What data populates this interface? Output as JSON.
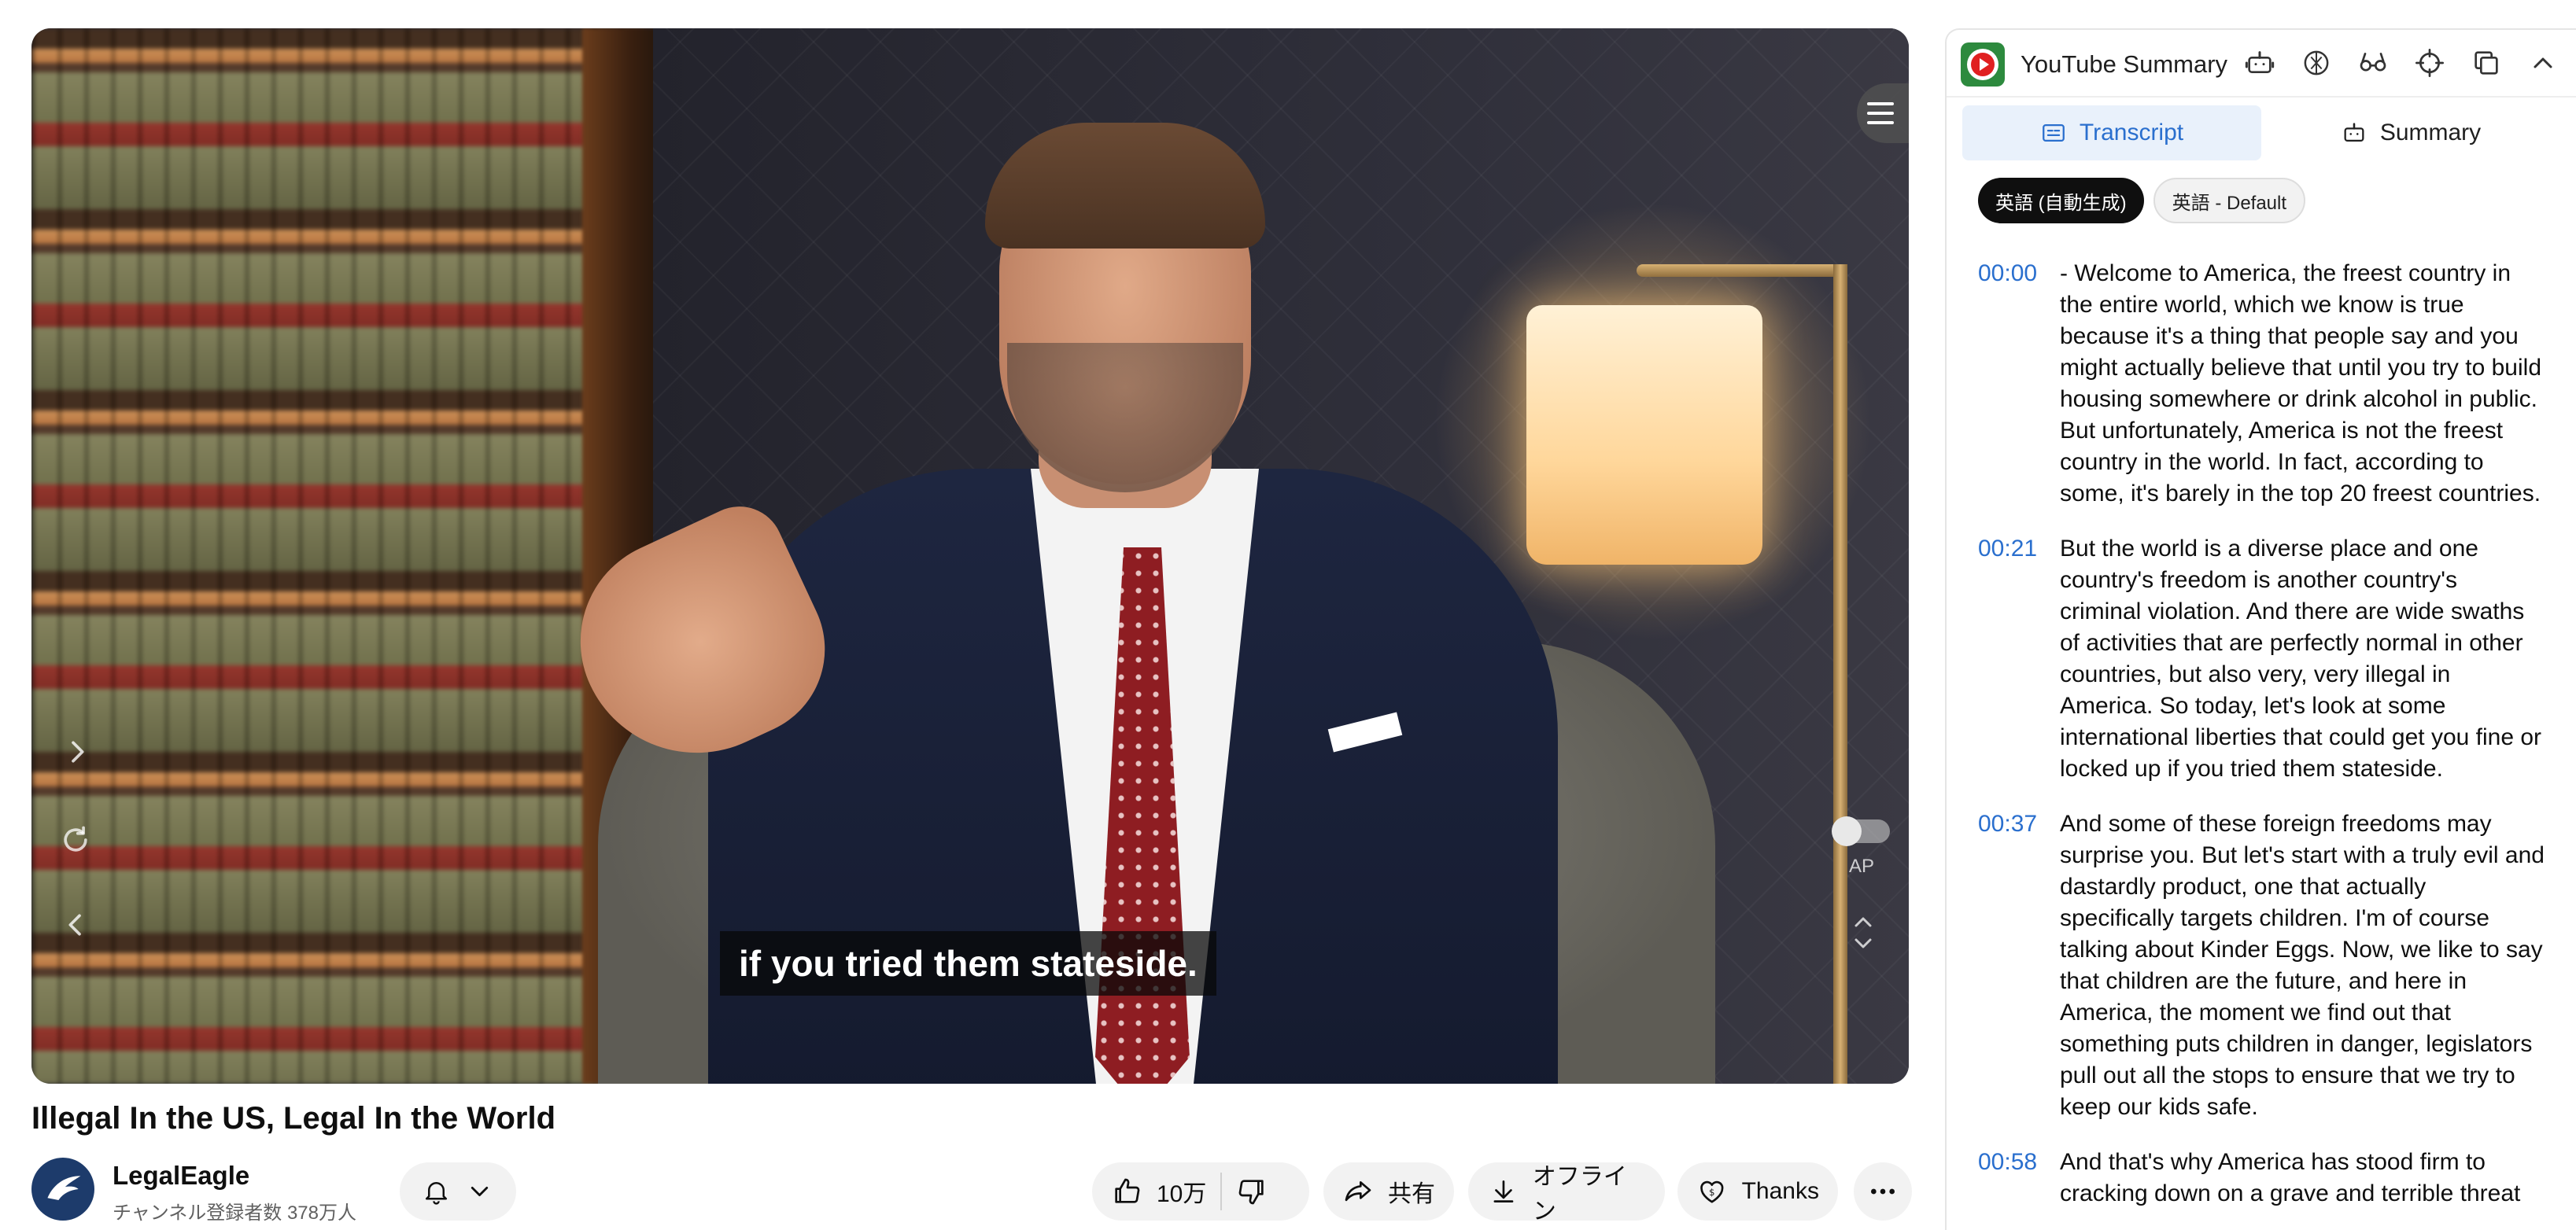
{
  "player": {
    "caption": "if you tried them stateside.",
    "ap_label": "AP"
  },
  "video": {
    "title": "Illegal In the US, Legal In the World",
    "channel_name": "LegalEagle",
    "subscribers": "チャンネル登録者数 378万人",
    "like_count": "10万",
    "share_label": "共有",
    "offline_label": "オフライン",
    "thanks_label": "Thanks"
  },
  "sidebar": {
    "title": "YouTube Summary",
    "header_icons": [
      "robot-icon",
      "openai-icon",
      "glasses-icon",
      "crosshair-icon",
      "copy-icon",
      "chevron-up-icon"
    ],
    "tabs": [
      {
        "label": "Transcript",
        "icon": "transcript-icon",
        "active": true
      },
      {
        "label": "Summary",
        "icon": "robot-icon",
        "active": false
      }
    ],
    "languages": [
      {
        "label": "英語 (自動生成)",
        "active": true
      },
      {
        "label": "英語 - Default",
        "active": false
      }
    ],
    "transcript": [
      {
        "time": "00:00",
        "text": "- Welcome to America, the freest country in the entire world, which we know is true because it's a thing that people say and you might actually believe that until you try to build housing somewhere or drink alcohol in public. But unfortunately, America is not the freest country in the world. In fact, according to some, it's barely in the top 20 freest countries."
      },
      {
        "time": "00:21",
        "text": "But the world is a diverse place and one country's freedom is another country's criminal violation. And there are wide swaths of activities that are perfectly normal in other countries, but also very, very illegal in America. So today, let's look at some international liberties that could get you fine or locked up if you tried them stateside."
      },
      {
        "time": "00:37",
        "text": "And some of these foreign freedoms may surprise you. But let's start with a truly evil and dastardly product, one that actually specifically targets children. I'm of course talking about Kinder Eggs. Now, we like to say that children are the future, and here in America, the moment we find out that something puts children in danger, legislators pull out all the stops to ensure that we try to keep our kids safe."
      },
      {
        "time": "00:58",
        "text": "And that's why America has stood firm to cracking down on a grave and terrible threat"
      }
    ]
  },
  "colors": {
    "accent_blue": "#2a6fce",
    "tab_active_bg": "#e9f1fb",
    "logo_green": "#2d8a3e",
    "logo_red": "#e02020"
  }
}
